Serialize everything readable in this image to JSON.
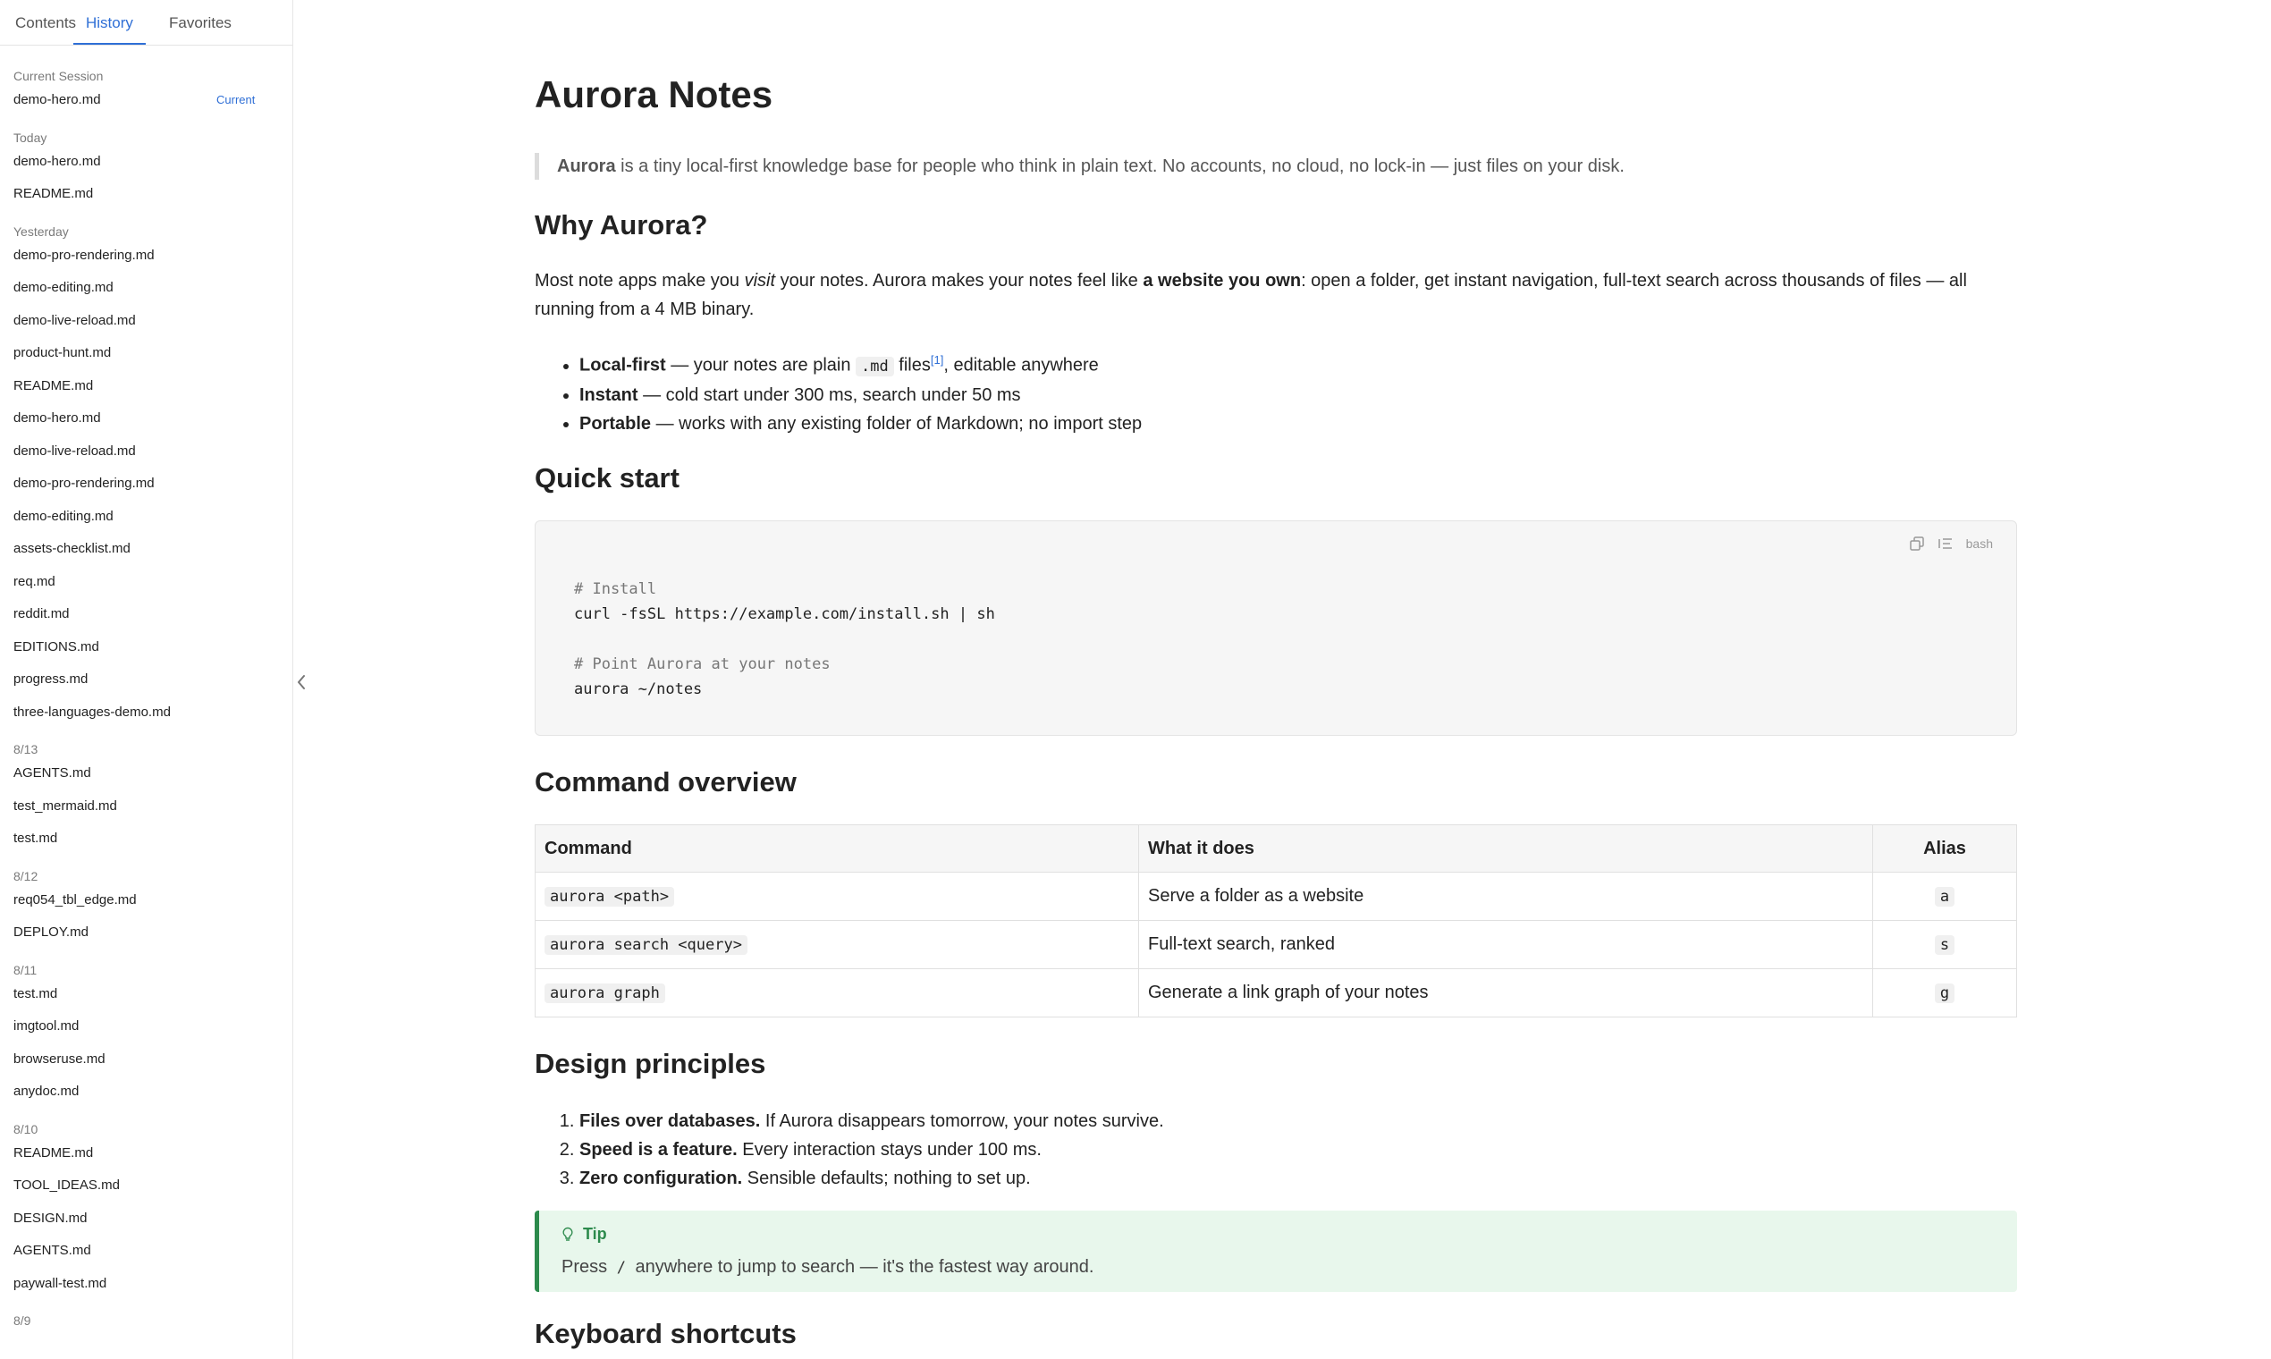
{
  "sidebar": {
    "tabs": [
      {
        "label": "Contents"
      },
      {
        "label": "History"
      },
      {
        "label": "Favorites"
      }
    ],
    "groups": [
      {
        "label": "Current Session",
        "items": [
          {
            "name": "demo-hero.md",
            "badge": "Current"
          }
        ]
      },
      {
        "label": "Today",
        "items": [
          {
            "name": "demo-hero.md"
          },
          {
            "name": "README.md"
          }
        ]
      },
      {
        "label": "Yesterday",
        "items": [
          {
            "name": "demo-pro-rendering.md"
          },
          {
            "name": "demo-editing.md"
          },
          {
            "name": "demo-live-reload.md"
          },
          {
            "name": "product-hunt.md"
          },
          {
            "name": "README.md"
          },
          {
            "name": "demo-hero.md"
          },
          {
            "name": "demo-live-reload.md"
          },
          {
            "name": "demo-pro-rendering.md"
          },
          {
            "name": "demo-editing.md"
          },
          {
            "name": "assets-checklist.md"
          },
          {
            "name": "req.md"
          },
          {
            "name": "reddit.md"
          },
          {
            "name": "EDITIONS.md"
          },
          {
            "name": "progress.md"
          },
          {
            "name": "three-languages-demo.md"
          }
        ]
      },
      {
        "label": "8/13",
        "items": [
          {
            "name": "AGENTS.md"
          },
          {
            "name": "test_mermaid.md"
          },
          {
            "name": "test.md"
          }
        ]
      },
      {
        "label": "8/12",
        "items": [
          {
            "name": "req054_tbl_edge.md"
          },
          {
            "name": "DEPLOY.md"
          }
        ]
      },
      {
        "label": "8/11",
        "items": [
          {
            "name": "test.md"
          },
          {
            "name": "imgtool.md"
          },
          {
            "name": "browseruse.md"
          },
          {
            "name": "anydoc.md"
          }
        ]
      },
      {
        "label": "8/10",
        "items": [
          {
            "name": "README.md"
          },
          {
            "name": "TOOL_IDEAS.md"
          },
          {
            "name": "DESIGN.md"
          },
          {
            "name": "AGENTS.md"
          },
          {
            "name": "paywall-test.md"
          }
        ]
      },
      {
        "label": "8/9",
        "items": []
      }
    ]
  },
  "doc": {
    "title": "Aurora Notes",
    "intro": {
      "strong": "Aurora",
      "text": " is a tiny local-first knowledge base for people who think in plain text. No accounts, no cloud, no lock-in — just files on your disk."
    },
    "why": {
      "heading": "Why Aurora?",
      "p1a": "Most note apps make you ",
      "p1em": "visit",
      "p1b": " your notes. Aurora makes your notes feel like ",
      "p1strong": "a website you own",
      "p1c": ": open a folder, get instant navigation, full-text search across thousands of files — all",
      "p2": "running from a 4 MB binary.",
      "features": [
        {
          "strong": "Local-first",
          "pre": " — your notes are plain ",
          "code": ".md",
          "mid": " files",
          "sup": "[1]",
          "post": ", editable anywhere"
        },
        {
          "strong": "Instant",
          "pre": " — cold start under 300 ms, search under 50 ms"
        },
        {
          "strong": "Portable",
          "pre": " — works with any existing folder of Markdown; no import step"
        }
      ]
    },
    "quickstart": {
      "heading": "Quick start",
      "lang": "bash",
      "lines": [
        {
          "text": "# Install",
          "comment": true
        },
        {
          "text": "curl -fsSL https://example.com/install.sh | sh",
          "comment": false
        },
        {
          "text": "",
          "comment": false
        },
        {
          "text": "# Point Aurora at your notes",
          "comment": true
        },
        {
          "text": "aurora ~/notes",
          "comment": false
        }
      ]
    },
    "commands": {
      "heading": "Command overview",
      "headers": [
        "Command",
        "What it does",
        "Alias"
      ],
      "rows": [
        {
          "cmd": "aurora <path>",
          "desc": "Serve a folder as a website",
          "alias": "a"
        },
        {
          "cmd": "aurora search <query>",
          "desc": "Full-text search, ranked",
          "alias": "s"
        },
        {
          "cmd": "aurora graph",
          "desc": "Generate a link graph of your notes",
          "alias": "g"
        }
      ]
    },
    "principles": {
      "heading": "Design principles",
      "items": [
        {
          "strong": "Files over databases.",
          "text": " If Aurora disappears tomorrow, your notes survive."
        },
        {
          "strong": "Speed is a feature.",
          "text": " Every interaction stays under 100 ms."
        },
        {
          "strong": "Zero configuration.",
          "text": " Sensible defaults; nothing to set up."
        }
      ]
    },
    "tip": {
      "title": "Tip",
      "pre": "Press ",
      "key": "/",
      "post": " anywhere to jump to search — it's the fastest way around."
    },
    "shortcuts": {
      "heading": "Keyboard shortcuts"
    }
  }
}
